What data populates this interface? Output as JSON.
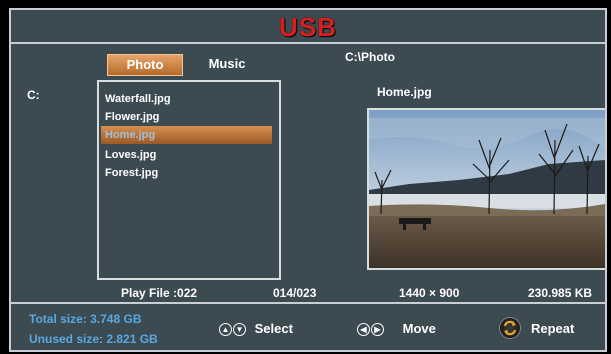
{
  "header": {
    "title": "USB"
  },
  "tabs": [
    {
      "label": "Photo",
      "active": true
    },
    {
      "label": "Music",
      "active": false
    }
  ],
  "current_path": "C:\\Photo",
  "drive_label": "C:",
  "files": [
    "Waterfall.jpg",
    "Flower.jpg",
    "Home.jpg",
    "Loves.jpg",
    "Forest.jpg"
  ],
  "selected_file": "Home.jpg",
  "preview": {
    "filename": "Home.jpg",
    "image": "lake-landscape-photo"
  },
  "info": {
    "play_file": "Play File :022",
    "position": "014/023",
    "resolution": "1440 × 900",
    "file_size": "230.985 KB"
  },
  "storage": {
    "total": "Total size: 3.748 GB",
    "unused": "Unused size: 2.821 GB"
  },
  "hints": {
    "select": "Select",
    "move": "Move",
    "repeat": "Repeat"
  },
  "colors": {
    "title": "#d81e1e",
    "accent": "#c97a3a",
    "size_text": "#5aa8e0",
    "background": "#3c4a52"
  }
}
